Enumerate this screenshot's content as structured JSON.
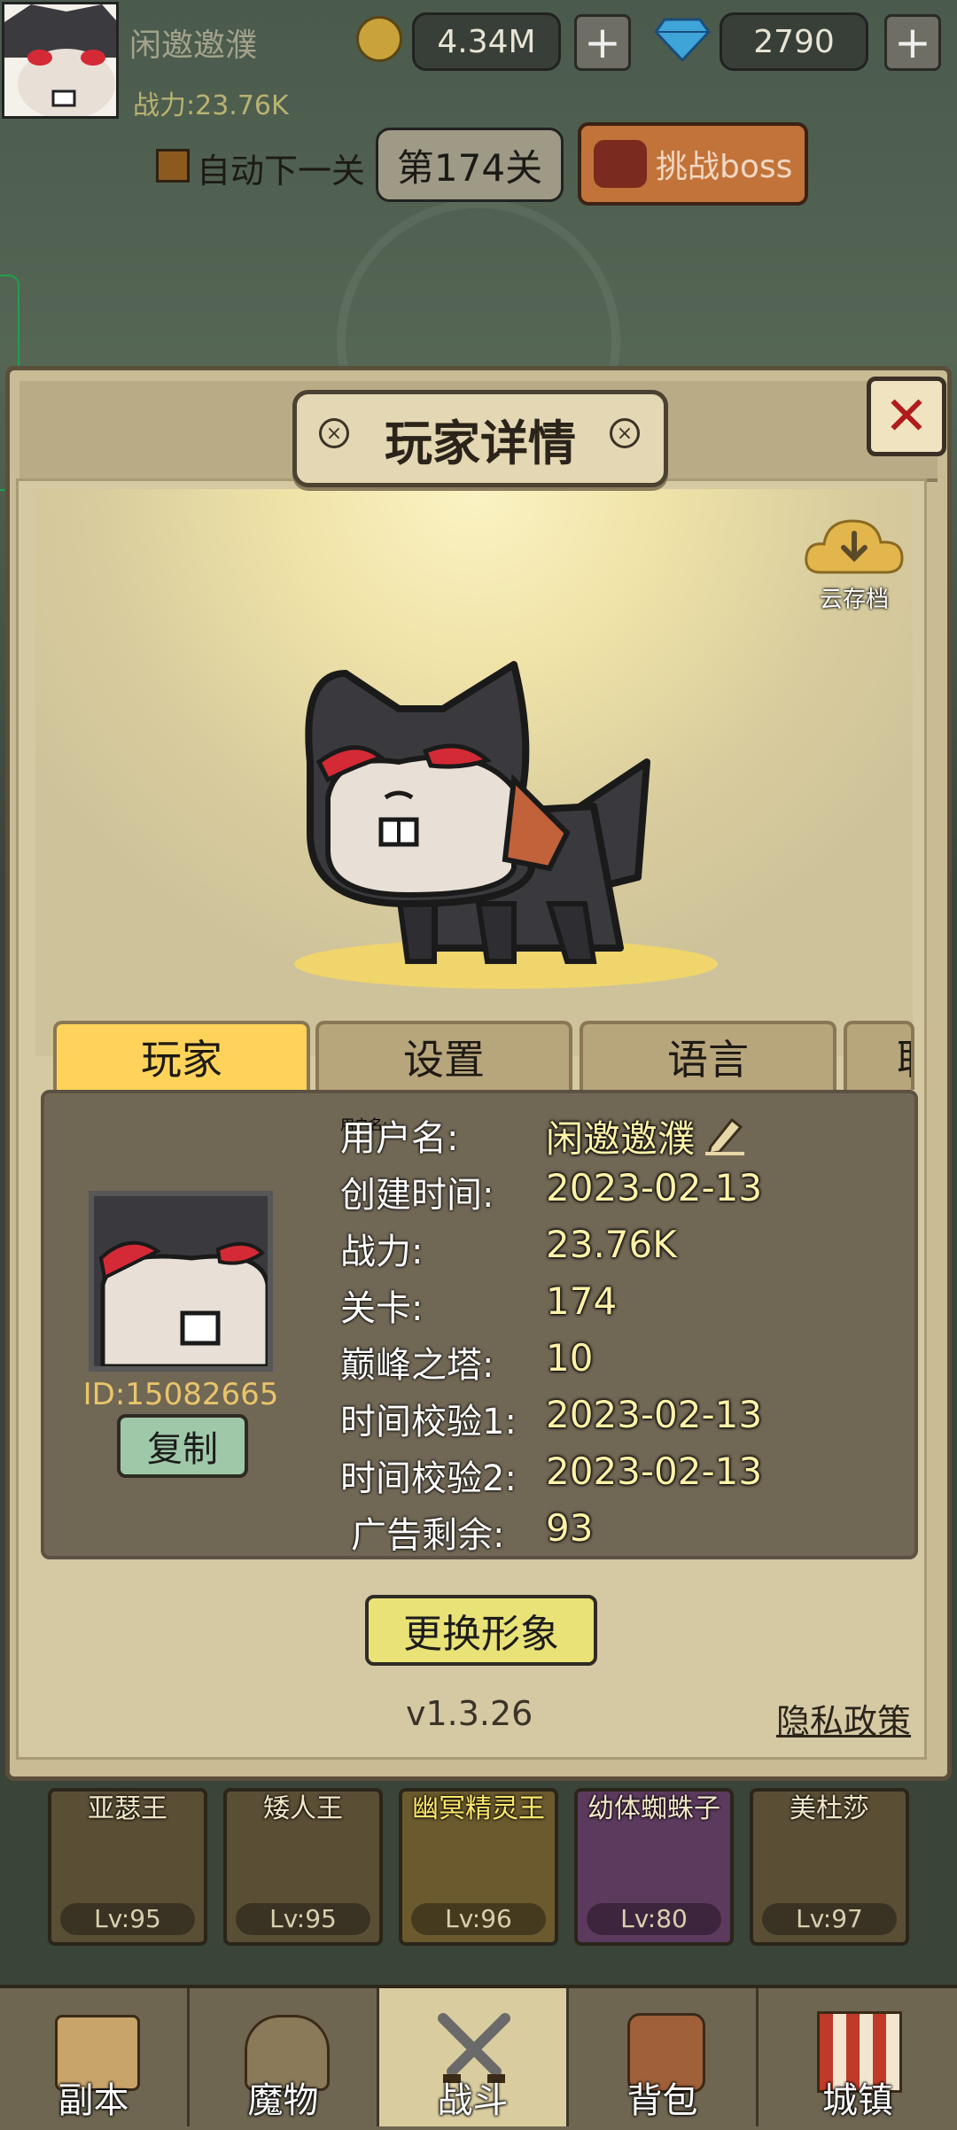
{
  "top_bar": {
    "player_name": "闲邀邀濮",
    "power": "战力:23.76K",
    "gold": "4.34M",
    "gems": "2790",
    "plus": "+",
    "auto_next_label": "自动下一关",
    "stage_label": "第174关",
    "boss_label": "挑战boss"
  },
  "modal": {
    "title": "玩家详情",
    "close": "✕",
    "cloud_label": "云存档",
    "tabs": [
      {
        "label": "玩家",
        "active": true
      },
      {
        "label": "设置",
        "active": false
      },
      {
        "label": "语言",
        "active": false
      },
      {
        "label": "联",
        "active": false
      }
    ],
    "player_id": "ID:15082665",
    "copy_label": "复制",
    "info": [
      {
        "label": "用户名:",
        "value": "闲邀邀濮"
      },
      {
        "label": "创建时间:",
        "value": "2023-02-13"
      },
      {
        "label": "战力:",
        "value": "23.76K"
      },
      {
        "label": "关卡:",
        "value": "174"
      },
      {
        "label": "巅峰之塔:",
        "value": "10"
      },
      {
        "label": "时间校验1:",
        "value": "2023-02-13"
      },
      {
        "label": "时间校验2:",
        "value": "2023-02-13"
      },
      {
        "label": "广告剩余:",
        "value": "93"
      }
    ],
    "change_avatar_label": "更换形象",
    "version": "v1.3.26",
    "privacy_label": "隐私政策"
  },
  "heroes": [
    {
      "name": "亚瑟王",
      "level": "Lv:95"
    },
    {
      "name": "矮人王",
      "level": "Lv:95"
    },
    {
      "name": "幽冥精灵王",
      "level": "Lv:96"
    },
    {
      "name": "幼体蜘蛛子",
      "level": "Lv:80"
    },
    {
      "name": "美杜莎",
      "level": "Lv:97"
    }
  ],
  "bottom_nav": [
    {
      "label": "副本",
      "active": false
    },
    {
      "label": "魔物",
      "active": false
    },
    {
      "label": "战斗",
      "active": true
    },
    {
      "label": "背包",
      "active": false
    },
    {
      "label": "城镇",
      "active": false
    }
  ],
  "colors": {
    "accent_yellow": "#ffd35a",
    "value_text": "#fff2a8",
    "close_red": "#b01c1c"
  }
}
